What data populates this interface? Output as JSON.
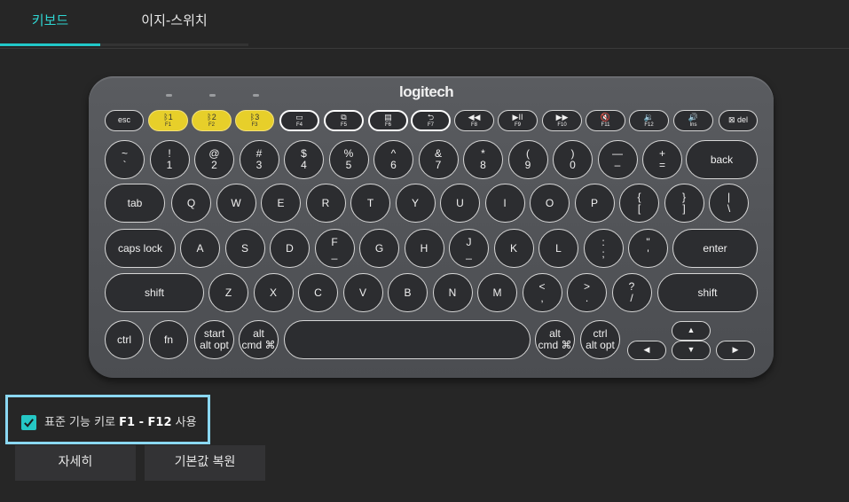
{
  "tabs": [
    {
      "label": "키보드",
      "active": true
    },
    {
      "label": "이지-스위치",
      "active": false
    }
  ],
  "keyboard": {
    "brand": "logitech",
    "fn_row": [
      {
        "main": "esc",
        "sub": ""
      },
      {
        "main": "ᛒ1",
        "sub": "F1"
      },
      {
        "main": "ᛒ2",
        "sub": "F2"
      },
      {
        "main": "ᛒ3",
        "sub": "F3"
      },
      {
        "main": "▭",
        "sub": "F4"
      },
      {
        "main": "⧉",
        "sub": "F5"
      },
      {
        "main": "▤",
        "sub": "F6"
      },
      {
        "main": "⮌",
        "sub": "F7"
      },
      {
        "main": "◀◀",
        "sub": "F8"
      },
      {
        "main": "▶II",
        "sub": "F9"
      },
      {
        "main": "▶▶",
        "sub": "F10"
      },
      {
        "main": "🔇",
        "sub": "F11"
      },
      {
        "main": "🔉",
        "sub": "F12"
      },
      {
        "main": "🔊",
        "sub": "Ins"
      },
      {
        "main": "⊠ del",
        "sub": ""
      }
    ],
    "num_row": [
      {
        "top": "~",
        "bot": "`"
      },
      {
        "top": "!",
        "bot": "1"
      },
      {
        "top": "@",
        "bot": "2"
      },
      {
        "top": "#",
        "bot": "3"
      },
      {
        "top": "$",
        "bot": "4"
      },
      {
        "top": "%",
        "bot": "5"
      },
      {
        "top": "^",
        "bot": "6"
      },
      {
        "top": "&",
        "bot": "7"
      },
      {
        "top": "*",
        "bot": "8"
      },
      {
        "top": "(",
        "bot": "9"
      },
      {
        "top": ")",
        "bot": "0"
      },
      {
        "top": "—",
        "bot": "–"
      },
      {
        "top": "+",
        "bot": "="
      },
      {
        "top": "back",
        "bot": ""
      }
    ],
    "row_q": [
      {
        "top": "tab",
        "bot": ""
      },
      {
        "top": "Q",
        "bot": ""
      },
      {
        "top": "W",
        "bot": ""
      },
      {
        "top": "E",
        "bot": ""
      },
      {
        "top": "R",
        "bot": ""
      },
      {
        "top": "T",
        "bot": ""
      },
      {
        "top": "Y",
        "bot": ""
      },
      {
        "top": "U",
        "bot": ""
      },
      {
        "top": "I",
        "bot": ""
      },
      {
        "top": "O",
        "bot": ""
      },
      {
        "top": "P",
        "bot": ""
      },
      {
        "top": "{",
        "bot": "["
      },
      {
        "top": "}",
        "bot": "]"
      },
      {
        "top": "|",
        "bot": "\\"
      }
    ],
    "row_a": [
      {
        "top": "caps lock",
        "bot": ""
      },
      {
        "top": "A",
        "bot": ""
      },
      {
        "top": "S",
        "bot": ""
      },
      {
        "top": "D",
        "bot": ""
      },
      {
        "top": "F",
        "bot": "_"
      },
      {
        "top": "G",
        "bot": ""
      },
      {
        "top": "H",
        "bot": ""
      },
      {
        "top": "J",
        "bot": "_"
      },
      {
        "top": "K",
        "bot": ""
      },
      {
        "top": "L",
        "bot": ""
      },
      {
        "top": ":",
        "bot": ";"
      },
      {
        "top": "\"",
        "bot": "'"
      },
      {
        "top": "enter",
        "bot": ""
      }
    ],
    "row_z": [
      {
        "top": "shift",
        "bot": ""
      },
      {
        "top": "Z",
        "bot": ""
      },
      {
        "top": "X",
        "bot": ""
      },
      {
        "top": "C",
        "bot": ""
      },
      {
        "top": "V",
        "bot": ""
      },
      {
        "top": "B",
        "bot": ""
      },
      {
        "top": "N",
        "bot": ""
      },
      {
        "top": "M",
        "bot": ""
      },
      {
        "top": "<",
        "bot": ","
      },
      {
        "top": ">",
        "bot": "."
      },
      {
        "top": "?",
        "bot": "/"
      },
      {
        "top": "shift",
        "bot": ""
      }
    ],
    "row_bottom": [
      {
        "top": "ctrl",
        "bot": ""
      },
      {
        "top": "fn",
        "bot": ""
      },
      {
        "top": "start",
        "bot": "alt opt"
      },
      {
        "top": "alt",
        "bot": "cmd ⌘"
      },
      {
        "top": "",
        "bot": ""
      },
      {
        "top": "alt",
        "bot": "cmd ⌘"
      },
      {
        "top": "ctrl",
        "bot": "alt opt"
      }
    ],
    "arrows": {
      "up": "▲",
      "left": "◀",
      "down": "▼",
      "right": "▶"
    }
  },
  "option": {
    "checked": true,
    "label_prefix": "표준 기능 키로",
    "label_keys": "F1 - F12",
    "label_suffix": "사용"
  },
  "buttons": {
    "details": "자세히",
    "restore_defaults": "기본값 복원"
  },
  "colors": {
    "accent": "#25c7c5",
    "highlight_border": "#8bd8f2",
    "yellow_key": "#e7cf2a"
  }
}
